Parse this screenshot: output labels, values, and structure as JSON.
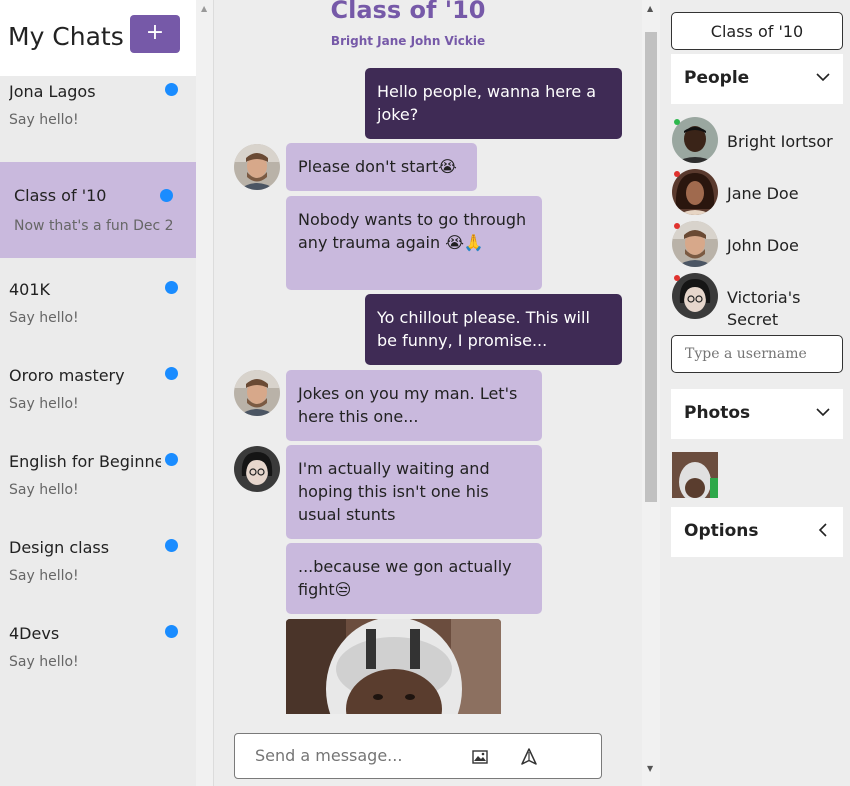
{
  "sidebar": {
    "title": "My Chats",
    "new_chat_label": "+",
    "chats": [
      {
        "name": "Jona Lagos",
        "preview": "Say hello!"
      },
      {
        "name": "Class of '10",
        "preview": "Now that's a fun Dec 2"
      },
      {
        "name": "401K",
        "preview": "Say hello!"
      },
      {
        "name": "Ororo mastery",
        "preview": "Say hello!"
      },
      {
        "name": "English for Beginners",
        "preview": "Say hello!"
      },
      {
        "name": "Design class",
        "preview": "Say hello!"
      },
      {
        "name": "4Devs",
        "preview": "Say hello!"
      }
    ]
  },
  "conversation": {
    "title": "Class of '10",
    "members": "Bright Jane John Vickie",
    "messages": [
      {
        "text": "Hello people, wanna here a joke?"
      },
      {
        "text": "Please don't start😭"
      },
      {
        "text": "Nobody wants to go through any trauma again 😭🙏"
      },
      {
        "text": "Yo chillout please. This will be funny, I promise..."
      },
      {
        "text": "Jokes on you my man. Let's here this one..."
      },
      {
        "text": "I'm actually waiting and hoping this isn't one his usual stunts"
      },
      {
        "text": "...because we gon actually fight😒"
      }
    ]
  },
  "composer": {
    "placeholder": "Send a message...",
    "image_icon": "image-icon",
    "send_icon": "send-icon"
  },
  "details": {
    "group_name": "Class of '10",
    "people_label": "People",
    "people": [
      {
        "name": "Bright Iortsor",
        "status_color": "#2db84d"
      },
      {
        "name": "Jane Doe",
        "status_color": "#e0322e"
      },
      {
        "name": "John Doe",
        "status_color": "#e0322e"
      },
      {
        "name": "Victoria's Secret",
        "status_color": "#e0322e"
      }
    ],
    "username_placeholder": "Type a username",
    "photos_label": "Photos",
    "options_label": "Options"
  },
  "colors": {
    "accent": "#7659a8",
    "outgoing_bubble": "#3f2b55",
    "incoming_bubble": "#c9b9dd",
    "unread_dot": "#1a8cff"
  }
}
